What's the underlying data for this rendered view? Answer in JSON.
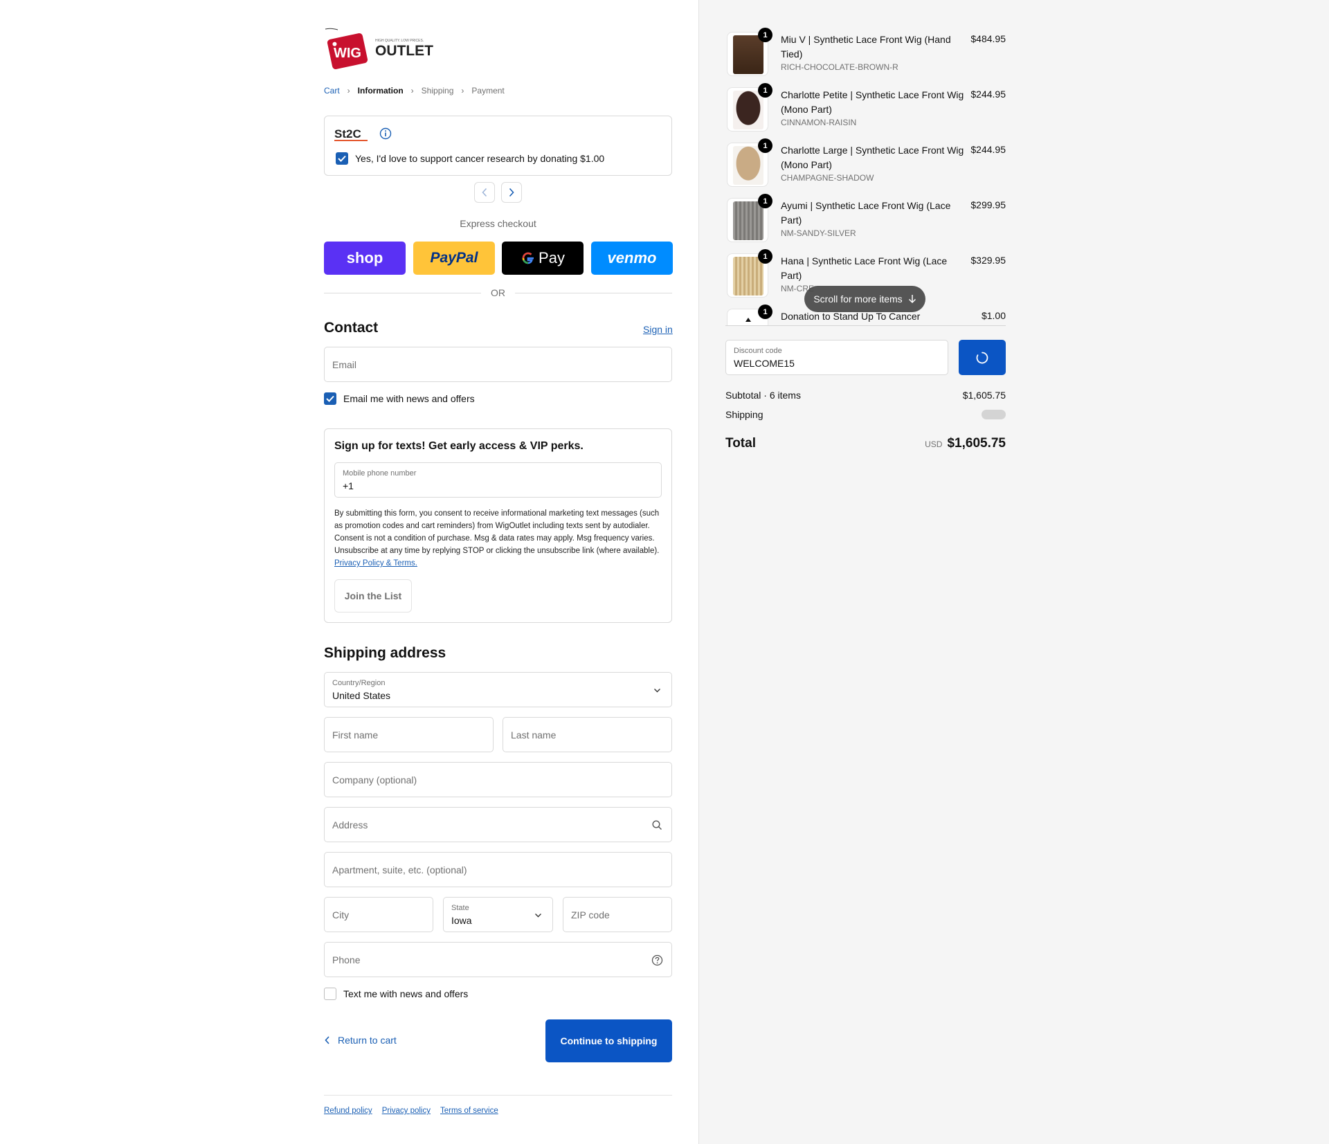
{
  "brand": {
    "logo_word_left": "WIG",
    "logo_word_right": "OUTLET",
    "tagline": "HIGH QUALITY. LOW PRICES."
  },
  "breadcrumb": {
    "cart": "Cart",
    "information": "Information",
    "shipping": "Shipping",
    "payment": "Payment"
  },
  "donation": {
    "logo_text": "St2C",
    "checkbox_label": "Yes, I'd love to support cancer research by donating $1.00",
    "checked": true
  },
  "express": {
    "title": "Express checkout",
    "buttons": [
      "shop",
      "PayPal",
      "Pay",
      "venmo"
    ],
    "or_label": "OR"
  },
  "contact": {
    "heading": "Contact",
    "sign_in": "Sign in",
    "email_placeholder": "Email",
    "news_label": "Email me with news and offers",
    "news_checked": true
  },
  "sms": {
    "title": "Sign up for texts! Get early access & VIP perks.",
    "phone_label": "Mobile phone number",
    "phone_value": "+1",
    "legal": "By submitting this form, you consent to receive informational marketing text messages (such as promotion codes and cart reminders) from WigOutlet including texts sent by autodialer. Consent is not a condition of purchase. Msg & data rates may apply. Msg frequency varies. Unsubscribe at any time by replying STOP or clicking the unsubscribe link (where available).",
    "legal_link": "Privacy Policy & Terms.",
    "join_button": "Join the List"
  },
  "shipping": {
    "heading": "Shipping address",
    "country_label": "Country/Region",
    "country_value": "United States",
    "first_name": "First name",
    "last_name": "Last name",
    "company": "Company (optional)",
    "address": "Address",
    "apartment": "Apartment, suite, etc. (optional)",
    "city": "City",
    "state_label": "State",
    "state_value": "Iowa",
    "zip": "ZIP code",
    "phone": "Phone",
    "text_label": "Text me with news and offers",
    "text_checked": false
  },
  "actions": {
    "return_label": "Return to cart",
    "continue_label": "Continue to shipping"
  },
  "footer": {
    "links": [
      "Refund policy",
      "Privacy policy",
      "Terms of service"
    ]
  },
  "order": {
    "items": [
      {
        "name": "Miu V | Synthetic Lace Front Wig (Hand Tied)",
        "variant": "RICH-CHOCOLATE-BROWN-R",
        "price": "$484.95",
        "qty": "1",
        "swatch": "#4a3323"
      },
      {
        "name": "Charlotte Petite | Synthetic Lace Front Wig (Mono Part)",
        "variant": "CINNAMON-RAISIN",
        "price": "$244.95",
        "qty": "1",
        "swatch": "#3b2520"
      },
      {
        "name": "Charlotte Large | Synthetic Lace Front Wig (Mono Part)",
        "variant": "CHAMPAGNE-SHADOW",
        "price": "$244.95",
        "qty": "1",
        "swatch": "#c9ab85"
      },
      {
        "name": "Ayumi | Synthetic Lace Front Wig (Lace Part)",
        "variant": "NM-SANDY-SILVER",
        "price": "$299.95",
        "qty": "1",
        "swatch": "#8c8a87"
      },
      {
        "name": "Hana | Synthetic Lace Front Wig (Lace Part)",
        "variant": "NM-CRE",
        "price": "$329.95",
        "qty": "1",
        "swatch": "#d9c294"
      },
      {
        "name": "Donation to Stand Up To Cancer",
        "variant": "",
        "price": "$1.00",
        "qty": "1",
        "swatch": "#ffffff"
      }
    ],
    "scroll_hint": "Scroll for more items",
    "discount_label": "Discount code",
    "discount_value": "WELCOME15",
    "subtotal_label": "Subtotal · 6 items",
    "subtotal_value": "$1,605.75",
    "shipping_label": "Shipping",
    "total_label": "Total",
    "currency": "USD",
    "total_value": "$1,605.75"
  },
  "colors": {
    "accent": "#0b55c4",
    "link": "#1a5fb4",
    "shop_pay": "#5a31f4",
    "paypal": "#ffc439",
    "venmo": "#008cff",
    "sidebar_bg": "#f5f5f5"
  }
}
